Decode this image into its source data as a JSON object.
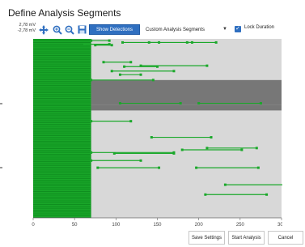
{
  "window": {
    "title": "Define Analysis Segments"
  },
  "toolbar": {
    "scale_top": "2,78 mV",
    "scale_bottom": "-2,78 mV",
    "icons": [
      "pan-icon",
      "zoom-in-icon",
      "zoom-out-icon",
      "save-icon"
    ],
    "show_detections_label": "Show Detections",
    "segment_type_value": "Custom Analysis Segments",
    "lock_duration_label": "Lock Duration",
    "lock_duration_checked": true
  },
  "colors": {
    "segment": "#1aa82a",
    "plot_bg": "#d8d8d8",
    "highlight_band": "#666666",
    "accent": "#2f6fc0"
  },
  "plot": {
    "x_ticks": [
      "0",
      "50",
      "100",
      "150",
      "200",
      "250",
      "300"
    ],
    "xlim": [
      0,
      300
    ],
    "dense_block": {
      "x_start": 0,
      "x_end": 70
    },
    "dark_bands": [
      {
        "x_start": 70,
        "x_end": 300,
        "y_start": 0.23,
        "y_end": 0.37
      },
      {
        "x_start": 70,
        "x_end": 300,
        "y_start": 0.37,
        "y_end": 0.4
      }
    ],
    "segments": [
      {
        "y": 0.01,
        "x0": 70,
        "x1": 92
      },
      {
        "y": 0.02,
        "x0": 108,
        "x1": 152
      },
      {
        "y": 0.02,
        "x0": 140,
        "x1": 192
      },
      {
        "y": 0.02,
        "x0": 186,
        "x1": 221
      },
      {
        "y": 0.03,
        "x0": 62,
        "x1": 92
      },
      {
        "y": 0.035,
        "x0": 75,
        "x1": 95
      },
      {
        "y": 0.13,
        "x0": 85,
        "x1": 118
      },
      {
        "y": 0.155,
        "x0": 110,
        "x1": 150
      },
      {
        "y": 0.15,
        "x0": 130,
        "x1": 210
      },
      {
        "y": 0.18,
        "x0": 95,
        "x1": 170
      },
      {
        "y": 0.2,
        "x0": 105,
        "x1": 130
      },
      {
        "y": 0.23,
        "x0": 70,
        "x1": 145
      },
      {
        "y": 0.36,
        "x0": 105,
        "x1": 178
      },
      {
        "y": 0.36,
        "x0": 200,
        "x1": 275
      },
      {
        "y": 0.46,
        "x0": 70,
        "x1": 118
      },
      {
        "y": 0.55,
        "x0": 143,
        "x1": 215
      },
      {
        "y": 0.61,
        "x0": 210,
        "x1": 270
      },
      {
        "y": 0.62,
        "x0": 180,
        "x1": 252
      },
      {
        "y": 0.635,
        "x0": 70,
        "x1": 170
      },
      {
        "y": 0.64,
        "x0": 98,
        "x1": 170
      },
      {
        "y": 0.68,
        "x0": 70,
        "x1": 130
      },
      {
        "y": 0.72,
        "x0": 78,
        "x1": 152
      },
      {
        "y": 0.72,
        "x0": 197,
        "x1": 272
      },
      {
        "y": 0.815,
        "x0": 232,
        "x1": 305
      },
      {
        "y": 0.87,
        "x0": 208,
        "x1": 282
      }
    ]
  },
  "footer": {
    "save_settings_label": "Save Settings",
    "start_analysis_label": "Start Analysis",
    "cancel_label": "Cancel"
  }
}
